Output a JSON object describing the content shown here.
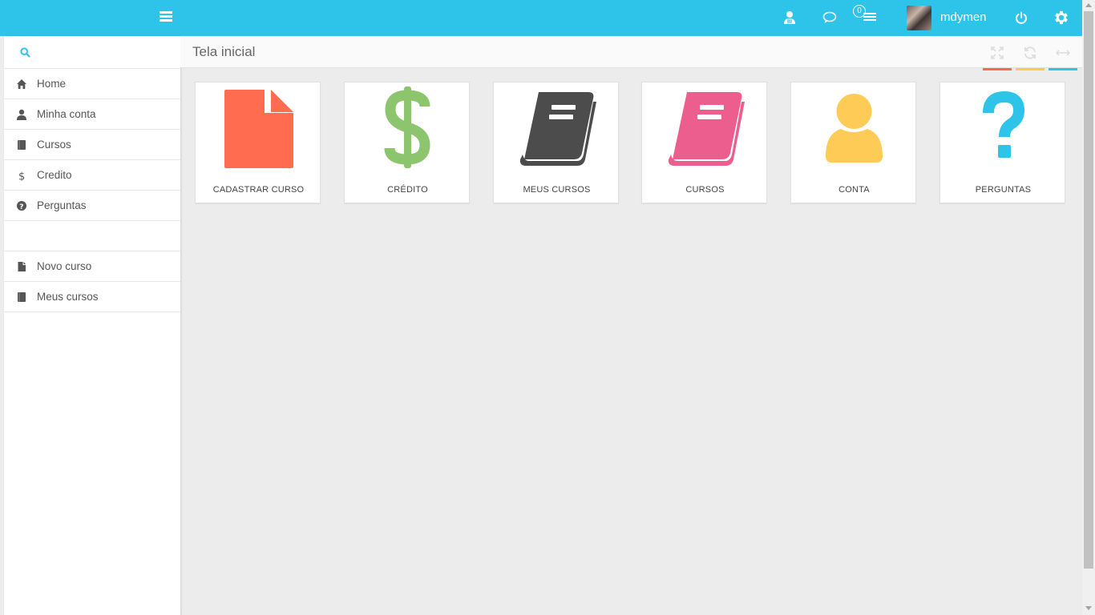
{
  "topbar": {
    "username": "mdymen",
    "notification_count": "0"
  },
  "sidebar": {
    "search_placeholder": "",
    "items": [
      {
        "label": "Home",
        "icon": "home-icon"
      },
      {
        "label": "Minha conta",
        "icon": "user-icon"
      },
      {
        "label": "Cursos",
        "icon": "book-icon"
      },
      {
        "label": "Credito",
        "icon": "dollar-icon"
      },
      {
        "label": "Perguntas",
        "icon": "question-circle-icon"
      }
    ],
    "items2": [
      {
        "label": "Novo curso",
        "icon": "file-icon"
      },
      {
        "label": "Meus cursos",
        "icon": "book-icon"
      }
    ]
  },
  "content": {
    "title": "Tela inicial",
    "controls": [
      {
        "icon": "expand-icon",
        "color": "#f26c4f"
      },
      {
        "icon": "refresh-icon",
        "color": "#ffc94a"
      },
      {
        "icon": "arrows-horizontal-icon",
        "color": "#2ec3e9"
      }
    ]
  },
  "tiles": [
    {
      "label": "CADASTRAR CURSO",
      "icon": "file-icon",
      "color": "#ff6c4f"
    },
    {
      "label": "CRÉDITO",
      "icon": "dollar-icon",
      "color": "#8cc56e"
    },
    {
      "label": "MEUS CURSOS",
      "icon": "book-icon",
      "color": "#4c4c4c"
    },
    {
      "label": "CURSOS",
      "icon": "book-icon",
      "color": "#ec5e8e"
    },
    {
      "label": "CONTA",
      "icon": "user-icon",
      "color": "#ffcb57"
    },
    {
      "label": "PERGUNTAS",
      "icon": "question-icon",
      "color": "#2ec3e9"
    }
  ]
}
